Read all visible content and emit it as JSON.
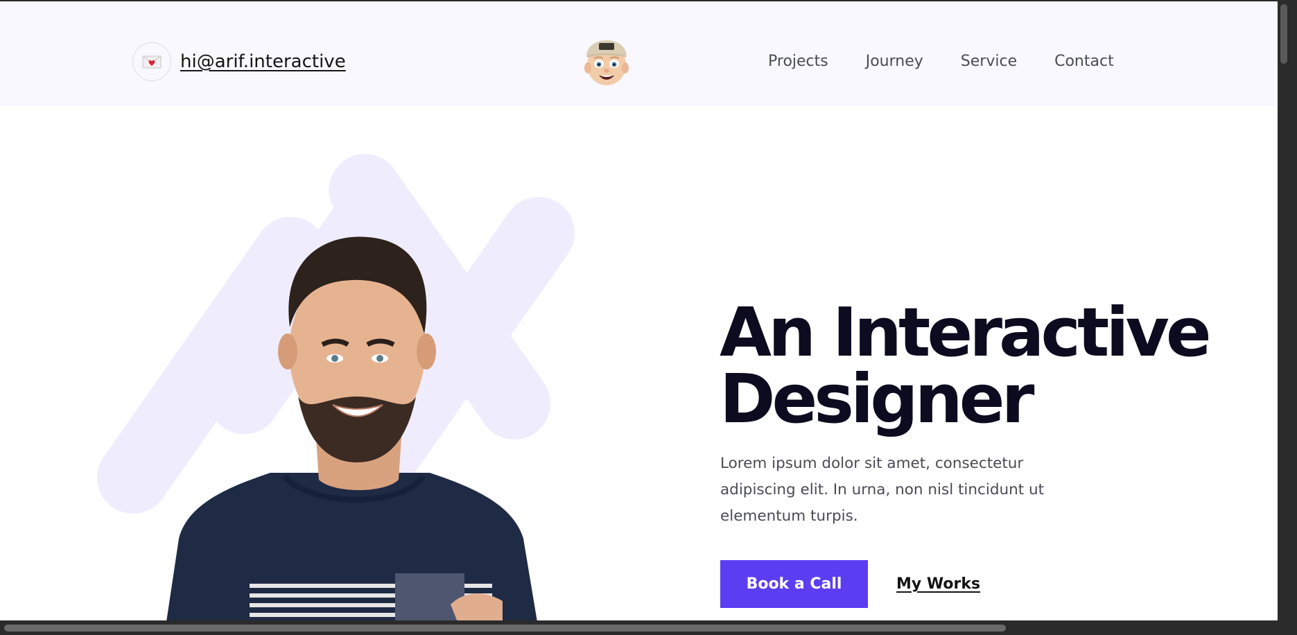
{
  "header": {
    "email": "hi@arif.interactive",
    "email_icon": "love-letter-icon",
    "avatar_icon": "memoji-avatar-icon",
    "nav": [
      {
        "label": "Projects"
      },
      {
        "label": "Journey"
      },
      {
        "label": "Service"
      },
      {
        "label": "Contact"
      }
    ]
  },
  "hero": {
    "title_line1": "An Interactive",
    "title_line2": "Designer",
    "description": "Lorem ipsum dolor sit amet, consectetur adipiscing elit. In urna, non nisl tincidunt ut elementum turpis.",
    "primary_cta": "Book a Call",
    "secondary_cta": "My Works",
    "portrait_icon": "portrait-photo"
  },
  "colors": {
    "accent": "#5b3ef2",
    "header_bg": "#f9f8fe",
    "stripe": "#efedfd",
    "title": "#0d0b1f",
    "text_muted": "#4a4a54"
  }
}
